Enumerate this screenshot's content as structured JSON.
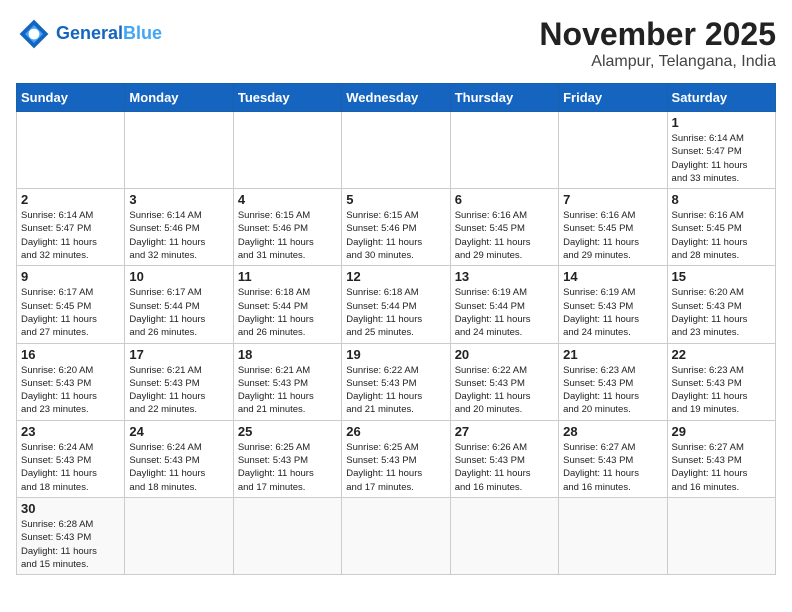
{
  "header": {
    "logo_general": "General",
    "logo_blue": "Blue",
    "month": "November 2025",
    "location": "Alampur, Telangana, India"
  },
  "weekdays": [
    "Sunday",
    "Monday",
    "Tuesday",
    "Wednesday",
    "Thursday",
    "Friday",
    "Saturday"
  ],
  "weeks": [
    [
      {
        "day": "",
        "info": ""
      },
      {
        "day": "",
        "info": ""
      },
      {
        "day": "",
        "info": ""
      },
      {
        "day": "",
        "info": ""
      },
      {
        "day": "",
        "info": ""
      },
      {
        "day": "",
        "info": ""
      },
      {
        "day": "1",
        "info": "Sunrise: 6:14 AM\nSunset: 5:47 PM\nDaylight: 11 hours\nand 33 minutes."
      }
    ],
    [
      {
        "day": "2",
        "info": "Sunrise: 6:14 AM\nSunset: 5:47 PM\nDaylight: 11 hours\nand 32 minutes."
      },
      {
        "day": "3",
        "info": "Sunrise: 6:14 AM\nSunset: 5:46 PM\nDaylight: 11 hours\nand 32 minutes."
      },
      {
        "day": "4",
        "info": "Sunrise: 6:15 AM\nSunset: 5:46 PM\nDaylight: 11 hours\nand 31 minutes."
      },
      {
        "day": "5",
        "info": "Sunrise: 6:15 AM\nSunset: 5:46 PM\nDaylight: 11 hours\nand 30 minutes."
      },
      {
        "day": "6",
        "info": "Sunrise: 6:16 AM\nSunset: 5:45 PM\nDaylight: 11 hours\nand 29 minutes."
      },
      {
        "day": "7",
        "info": "Sunrise: 6:16 AM\nSunset: 5:45 PM\nDaylight: 11 hours\nand 29 minutes."
      },
      {
        "day": "8",
        "info": "Sunrise: 6:16 AM\nSunset: 5:45 PM\nDaylight: 11 hours\nand 28 minutes."
      }
    ],
    [
      {
        "day": "9",
        "info": "Sunrise: 6:17 AM\nSunset: 5:45 PM\nDaylight: 11 hours\nand 27 minutes."
      },
      {
        "day": "10",
        "info": "Sunrise: 6:17 AM\nSunset: 5:44 PM\nDaylight: 11 hours\nand 26 minutes."
      },
      {
        "day": "11",
        "info": "Sunrise: 6:18 AM\nSunset: 5:44 PM\nDaylight: 11 hours\nand 26 minutes."
      },
      {
        "day": "12",
        "info": "Sunrise: 6:18 AM\nSunset: 5:44 PM\nDaylight: 11 hours\nand 25 minutes."
      },
      {
        "day": "13",
        "info": "Sunrise: 6:19 AM\nSunset: 5:44 PM\nDaylight: 11 hours\nand 24 minutes."
      },
      {
        "day": "14",
        "info": "Sunrise: 6:19 AM\nSunset: 5:43 PM\nDaylight: 11 hours\nand 24 minutes."
      },
      {
        "day": "15",
        "info": "Sunrise: 6:20 AM\nSunset: 5:43 PM\nDaylight: 11 hours\nand 23 minutes."
      }
    ],
    [
      {
        "day": "16",
        "info": "Sunrise: 6:20 AM\nSunset: 5:43 PM\nDaylight: 11 hours\nand 23 minutes."
      },
      {
        "day": "17",
        "info": "Sunrise: 6:21 AM\nSunset: 5:43 PM\nDaylight: 11 hours\nand 22 minutes."
      },
      {
        "day": "18",
        "info": "Sunrise: 6:21 AM\nSunset: 5:43 PM\nDaylight: 11 hours\nand 21 minutes."
      },
      {
        "day": "19",
        "info": "Sunrise: 6:22 AM\nSunset: 5:43 PM\nDaylight: 11 hours\nand 21 minutes."
      },
      {
        "day": "20",
        "info": "Sunrise: 6:22 AM\nSunset: 5:43 PM\nDaylight: 11 hours\nand 20 minutes."
      },
      {
        "day": "21",
        "info": "Sunrise: 6:23 AM\nSunset: 5:43 PM\nDaylight: 11 hours\nand 20 minutes."
      },
      {
        "day": "22",
        "info": "Sunrise: 6:23 AM\nSunset: 5:43 PM\nDaylight: 11 hours\nand 19 minutes."
      }
    ],
    [
      {
        "day": "23",
        "info": "Sunrise: 6:24 AM\nSunset: 5:43 PM\nDaylight: 11 hours\nand 18 minutes."
      },
      {
        "day": "24",
        "info": "Sunrise: 6:24 AM\nSunset: 5:43 PM\nDaylight: 11 hours\nand 18 minutes."
      },
      {
        "day": "25",
        "info": "Sunrise: 6:25 AM\nSunset: 5:43 PM\nDaylight: 11 hours\nand 17 minutes."
      },
      {
        "day": "26",
        "info": "Sunrise: 6:25 AM\nSunset: 5:43 PM\nDaylight: 11 hours\nand 17 minutes."
      },
      {
        "day": "27",
        "info": "Sunrise: 6:26 AM\nSunset: 5:43 PM\nDaylight: 11 hours\nand 16 minutes."
      },
      {
        "day": "28",
        "info": "Sunrise: 6:27 AM\nSunset: 5:43 PM\nDaylight: 11 hours\nand 16 minutes."
      },
      {
        "day": "29",
        "info": "Sunrise: 6:27 AM\nSunset: 5:43 PM\nDaylight: 11 hours\nand 16 minutes."
      }
    ],
    [
      {
        "day": "30",
        "info": "Sunrise: 6:28 AM\nSunset: 5:43 PM\nDaylight: 11 hours\nand 15 minutes."
      },
      {
        "day": "",
        "info": ""
      },
      {
        "day": "",
        "info": ""
      },
      {
        "day": "",
        "info": ""
      },
      {
        "day": "",
        "info": ""
      },
      {
        "day": "",
        "info": ""
      },
      {
        "day": "",
        "info": ""
      }
    ]
  ]
}
